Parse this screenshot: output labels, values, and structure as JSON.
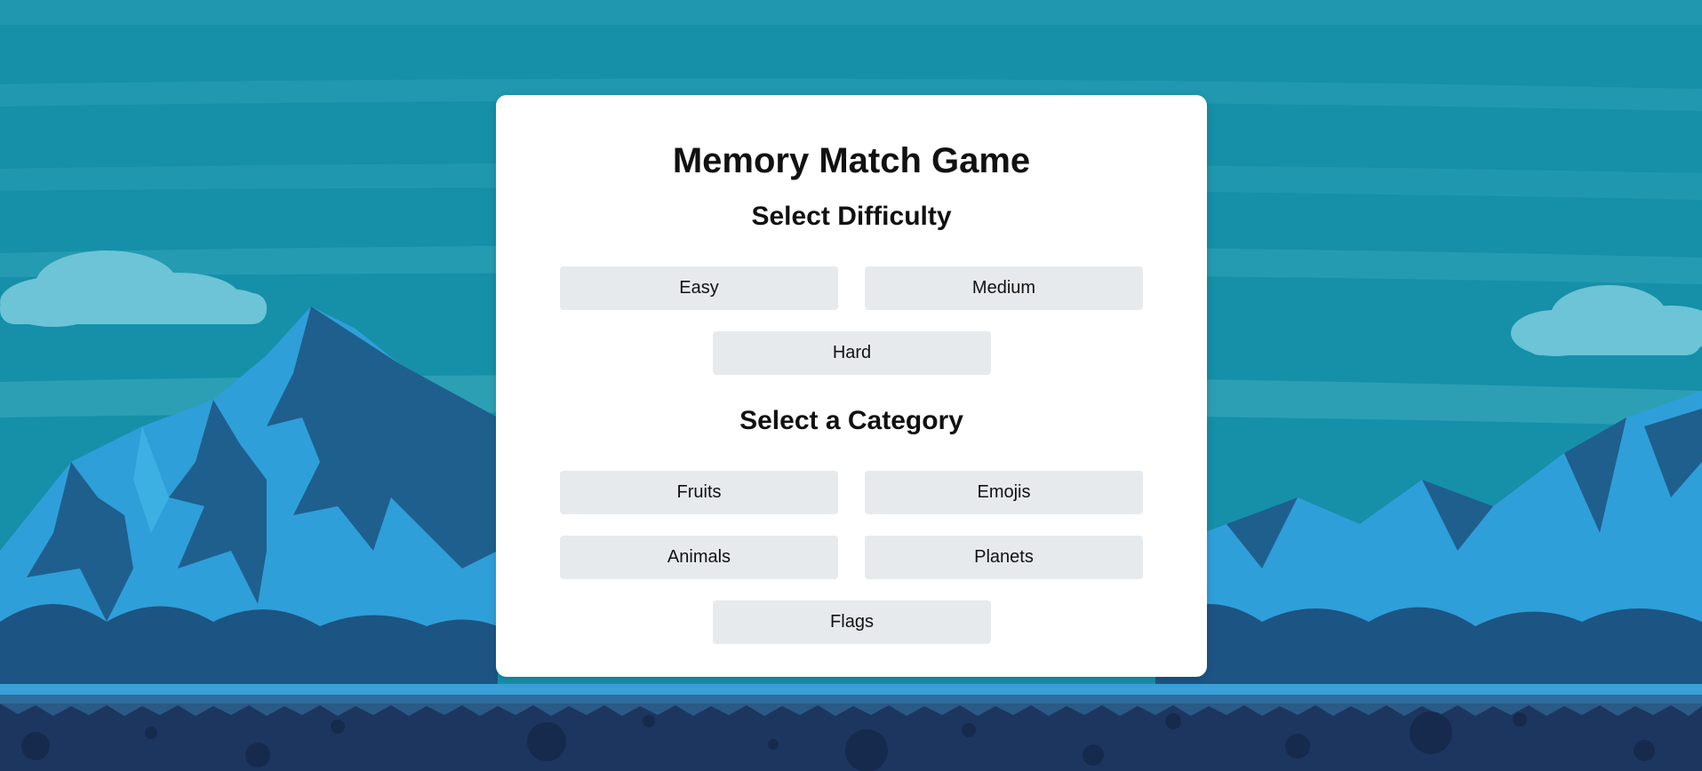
{
  "game": {
    "title": "Memory Match Game",
    "difficulty_heading": "Select Difficulty",
    "difficulty_options": [
      "Easy",
      "Medium",
      "Hard"
    ],
    "category_heading": "Select a Category",
    "category_options": [
      "Fruits",
      "Emojis",
      "Animals",
      "Planets",
      "Flags"
    ]
  },
  "theme": {
    "sky": "#1590a8",
    "mountain_light": "#2f9fd9",
    "mountain_dark": "#1f5f8e",
    "ground": "#1d3660",
    "button_bg": "#e7eaed",
    "card_bg": "#ffffff"
  }
}
